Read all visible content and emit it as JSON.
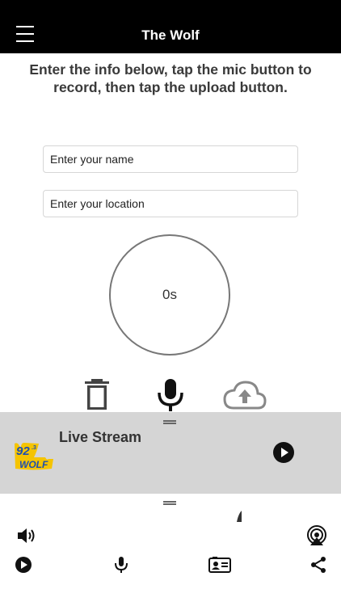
{
  "header": {
    "title": "The Wolf",
    "menu_icon": "hamburger-menu-icon"
  },
  "instructions": "Enter the info below, tap the mic button to record, then tap the upload button.",
  "form": {
    "name_placeholder": "Enter your name",
    "location_placeholder": "Enter your location"
  },
  "recorder": {
    "elapsed": "0s",
    "delete_icon": "trash-icon",
    "record_icon": "microphone-icon",
    "upload_icon": "cloud-upload-icon"
  },
  "player": {
    "station_logo": "92.3 WOLF",
    "label": "Live Stream",
    "play_icon": "play-icon"
  },
  "bottom_bar": {
    "icons": [
      "volume-icon",
      "airplay-icon",
      "play-icon",
      "microphone-icon",
      "contact-card-icon",
      "share-icon"
    ]
  },
  "colors": {
    "header_bg": "#000000",
    "player_bg": "#d5d5d5",
    "logo_yellow": "#f5c400",
    "logo_blue": "#1f4fb0"
  }
}
